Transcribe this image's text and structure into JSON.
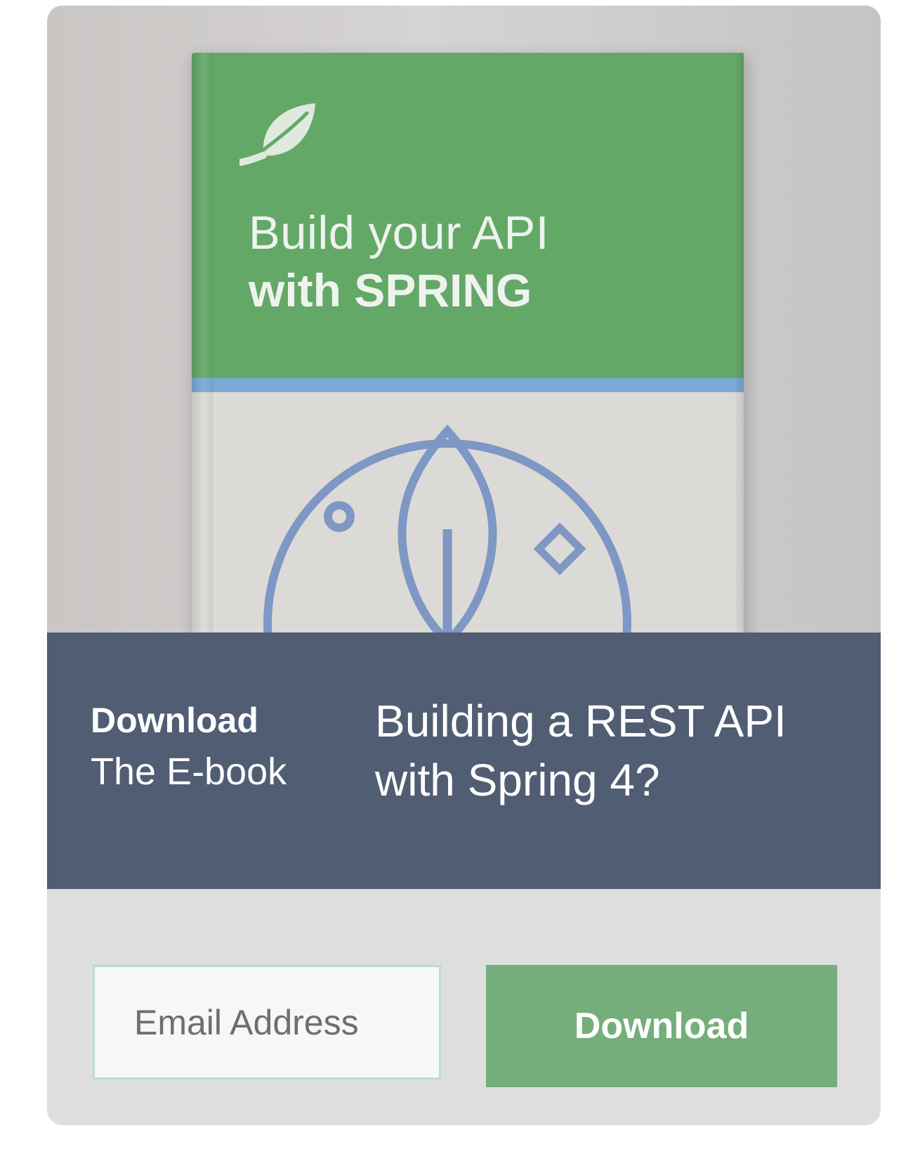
{
  "book_cover": {
    "title_line_1": "Build your API",
    "title_line_2": "with SPRING",
    "logo_icon": "leaf-icon",
    "emblem_icon": "plant-sprout-emblem",
    "colors": {
      "cover_green": "#63a867",
      "stripe_blue": "#7aa9d6",
      "cover_light": "#dcdad6",
      "emblem_blue": "#7e97c4"
    }
  },
  "promo": {
    "label_bold": "Download",
    "label_sub": "The E-book",
    "headline": "Building a REST API with Spring 4?",
    "band_color": "#515d72"
  },
  "form": {
    "email_placeholder": "Email Address",
    "email_value": "",
    "submit_label": "Download",
    "button_color": "#75ae7a"
  }
}
